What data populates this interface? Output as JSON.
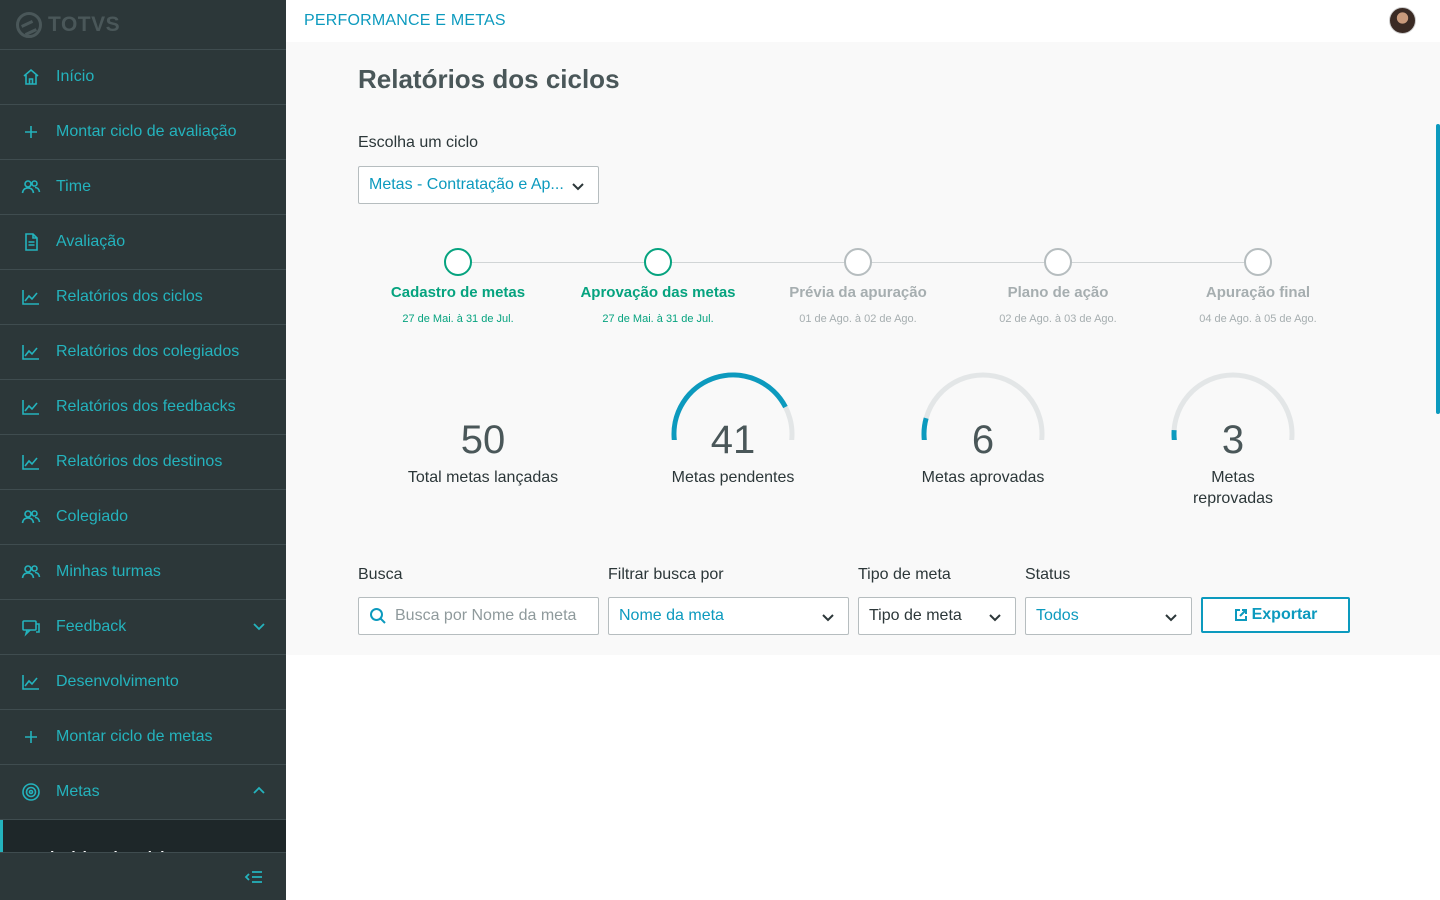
{
  "brand": {
    "logo_text": "TOTVS"
  },
  "sidebar": {
    "items": [
      {
        "label": "Início",
        "icon": "home-icon"
      },
      {
        "label": "Montar ciclo de avaliação",
        "icon": "plus-icon"
      },
      {
        "label": "Time",
        "icon": "users-icon"
      },
      {
        "label": "Avaliação",
        "icon": "document-icon"
      },
      {
        "label": "Relatórios dos ciclos",
        "icon": "chart-icon"
      },
      {
        "label": "Relatórios dos colegiados",
        "icon": "chart-icon"
      },
      {
        "label": "Relatórios dos feedbacks",
        "icon": "chart-icon"
      },
      {
        "label": "Relatórios dos destinos",
        "icon": "chart-icon"
      },
      {
        "label": "Colegiado",
        "icon": "users-icon"
      },
      {
        "label": "Minhas turmas",
        "icon": "users-icon"
      },
      {
        "label": "Feedback",
        "icon": "chat-icon",
        "expandable": "down"
      },
      {
        "label": "Desenvolvimento",
        "icon": "chart-icon"
      },
      {
        "label": "Montar ciclo de metas",
        "icon": "plus-icon"
      },
      {
        "label": "Metas",
        "icon": "target-icon",
        "expandable": "up"
      }
    ],
    "active_subitem": "Relatórios dos ciclos"
  },
  "header": {
    "title": "PERFORMANCE E METAS"
  },
  "page": {
    "title": "Relatórios dos ciclos",
    "cycle_label": "Escolha um ciclo",
    "cycle_value": "Metas - Contratação e Ap..."
  },
  "steps": [
    {
      "label": "Cadastro de metas",
      "dates": "27 de Mai. à 31 de Jul.",
      "done": true
    },
    {
      "label": "Aprovação das metas",
      "dates": "27 de Mai. à 31 de Jul.",
      "done": true
    },
    {
      "label": "Prévia da apuração",
      "dates": "01 de Ago. à 02 de Ago.",
      "done": false
    },
    {
      "label": "Plano de ação",
      "dates": "02 de Ago. à 03 de Ago.",
      "done": false
    },
    {
      "label": "Apuração final",
      "dates": "04 de Ago. à 05 de Ago.",
      "done": false
    }
  ],
  "stats": {
    "total": {
      "value": "50",
      "label": "Total metas lançadas"
    },
    "pending": {
      "value": "41",
      "label": "Metas pendentes",
      "fraction": 0.82
    },
    "approved": {
      "value": "6",
      "label": "Metas aprovadas",
      "fraction": 0.12
    },
    "rejected": {
      "value": "3",
      "label": "Metas reprovadas",
      "fraction": 0.06
    },
    "colors": {
      "track": "#e3e6e7",
      "fill": "#0c9abe"
    }
  },
  "filters": {
    "search_label": "Busca",
    "search_placeholder": "Busca por Nome da meta",
    "filter_by_label": "Filtrar busca por",
    "filter_by_value": "Nome da meta",
    "type_label": "Tipo de meta",
    "type_value": "Tipo de meta",
    "status_label": "Status",
    "status_value": "Todos",
    "export_label": "Exportar"
  },
  "colors": {
    "sidebar_bg": "#2c3739",
    "accent": "#24b3bd",
    "primary": "#0c9abe",
    "success": "#06a37f"
  }
}
